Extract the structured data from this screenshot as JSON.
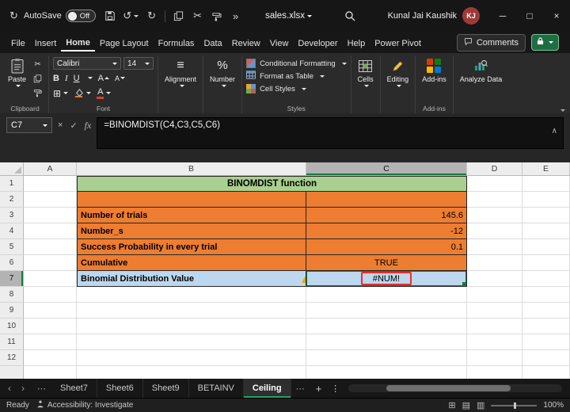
{
  "icons": {
    "autosave": "↻",
    "undo": "↺",
    "redo": "↻",
    "cut": "✂",
    "overflow": "»",
    "minimize": "─",
    "maximize": "□",
    "close": "×",
    "cancel": "×",
    "check": "✓",
    "fx": "fx",
    "expand_formula_bar": "∧",
    "borders": "⊞",
    "alignment": "≡",
    "percent": "%",
    "warning": "!",
    "nav_left": "‹",
    "nav_right": "›",
    "ellipsis": "⋯",
    "plus": "+",
    "tab_menu": "⋮",
    "view_normal": "⊞",
    "view_layout": "▤",
    "view_break": "▥"
  },
  "titlebar": {
    "autosave_label": "AutoSave",
    "autosave_state": "Off",
    "filename": "sales.xlsx",
    "user_name": "Kunal Jai Kaushik",
    "user_initials": "KJ"
  },
  "menubar": {
    "items": [
      "File",
      "Insert",
      "Home",
      "Page Layout",
      "Formulas",
      "Data",
      "Review",
      "View",
      "Developer",
      "Help",
      "Power Pivot"
    ],
    "active_item": "Home",
    "comments_label": "Comments"
  },
  "ribbon": {
    "paste_label": "Paste",
    "clipboard_group": "Clipboard",
    "font_name": "Calibri",
    "font_size": "14",
    "bold": "B",
    "italic": "I",
    "underline": "U",
    "font_color_glyph": "A",
    "grow_font_glyph": "A",
    "shrink_font_glyph": "A",
    "font_group": "Font",
    "alignment_label": "Alignment",
    "number_label": "Number",
    "conditional_formatting": "Conditional Formatting",
    "format_as_table": "Format as Table",
    "cell_styles": "Cell Styles",
    "styles_group": "Styles",
    "cells_label": "Cells",
    "editing_label": "Editing",
    "addins_label": "Add-ins",
    "addins_group": "Add-ins",
    "analyze_label": "Analyze Data"
  },
  "formula_bar": {
    "name_box": "C7",
    "formula": "=BINOMDIST(C4,C3,C5,C6)"
  },
  "grid": {
    "columns": [
      "A",
      "B",
      "C",
      "D",
      "E"
    ],
    "rows": [
      "1",
      "2",
      "3",
      "4",
      "5",
      "6",
      "7",
      "8",
      "9",
      "10",
      "11",
      "12"
    ],
    "selected_column": "C",
    "selected_row": "7",
    "title_cell": "BINOMDIST function",
    "cells": {
      "b3": "Number of trials",
      "c3": "145.6",
      "b4": "Number_s",
      "c4": "-12",
      "b5": "Success Probability in every trial",
      "c5": "0.1",
      "b6": "Cumulative",
      "c6": "TRUE",
      "b7": "Binomial Distribution Value",
      "c7": "#NUM!"
    },
    "colors": {
      "title_fill": "#A9D08E",
      "input_fill": "#ED7D31",
      "result_fill": "#BDD7EE",
      "error_box_border": "#E8312A",
      "selection_accent": "#107C41"
    }
  },
  "sheet_tabs": {
    "tabs": [
      "Sheet7",
      "Sheet6",
      "Sheet9",
      "BETAINV",
      "Ceiling"
    ],
    "active_tab": "Ceiling"
  },
  "status_bar": {
    "mode": "Ready",
    "accessibility": "Accessibility: Investigate",
    "zoom": "100%"
  }
}
